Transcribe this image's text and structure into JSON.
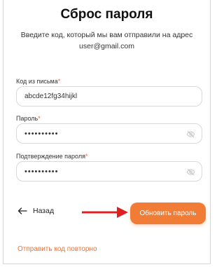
{
  "header": {
    "title": "Сброс пароля",
    "subtitle_line1": "Введите код, который мы вам отправили на адрес",
    "email": "user@gmail.com"
  },
  "fields": {
    "code": {
      "label": "Код из письма",
      "required_mark": "*",
      "value": "abcde12fg34hijkl"
    },
    "password": {
      "label": "Пароль",
      "required_mark": "*",
      "value": "••••••••••"
    },
    "confirm": {
      "label": "Подтверждение пароля",
      "required_mark": "*",
      "value": "••••••••••"
    }
  },
  "actions": {
    "back_label": "Назад",
    "submit_label": "Обновить пароль",
    "resend_label": "Отправить код повторно"
  },
  "icons": {
    "back": "arrow-left-icon",
    "visibility": "eye-slash-icon",
    "annotation": "red-arrow-icon"
  },
  "colors": {
    "accent": "#f07c35",
    "annotation_arrow": "#e02020",
    "required": "#e8643a"
  }
}
